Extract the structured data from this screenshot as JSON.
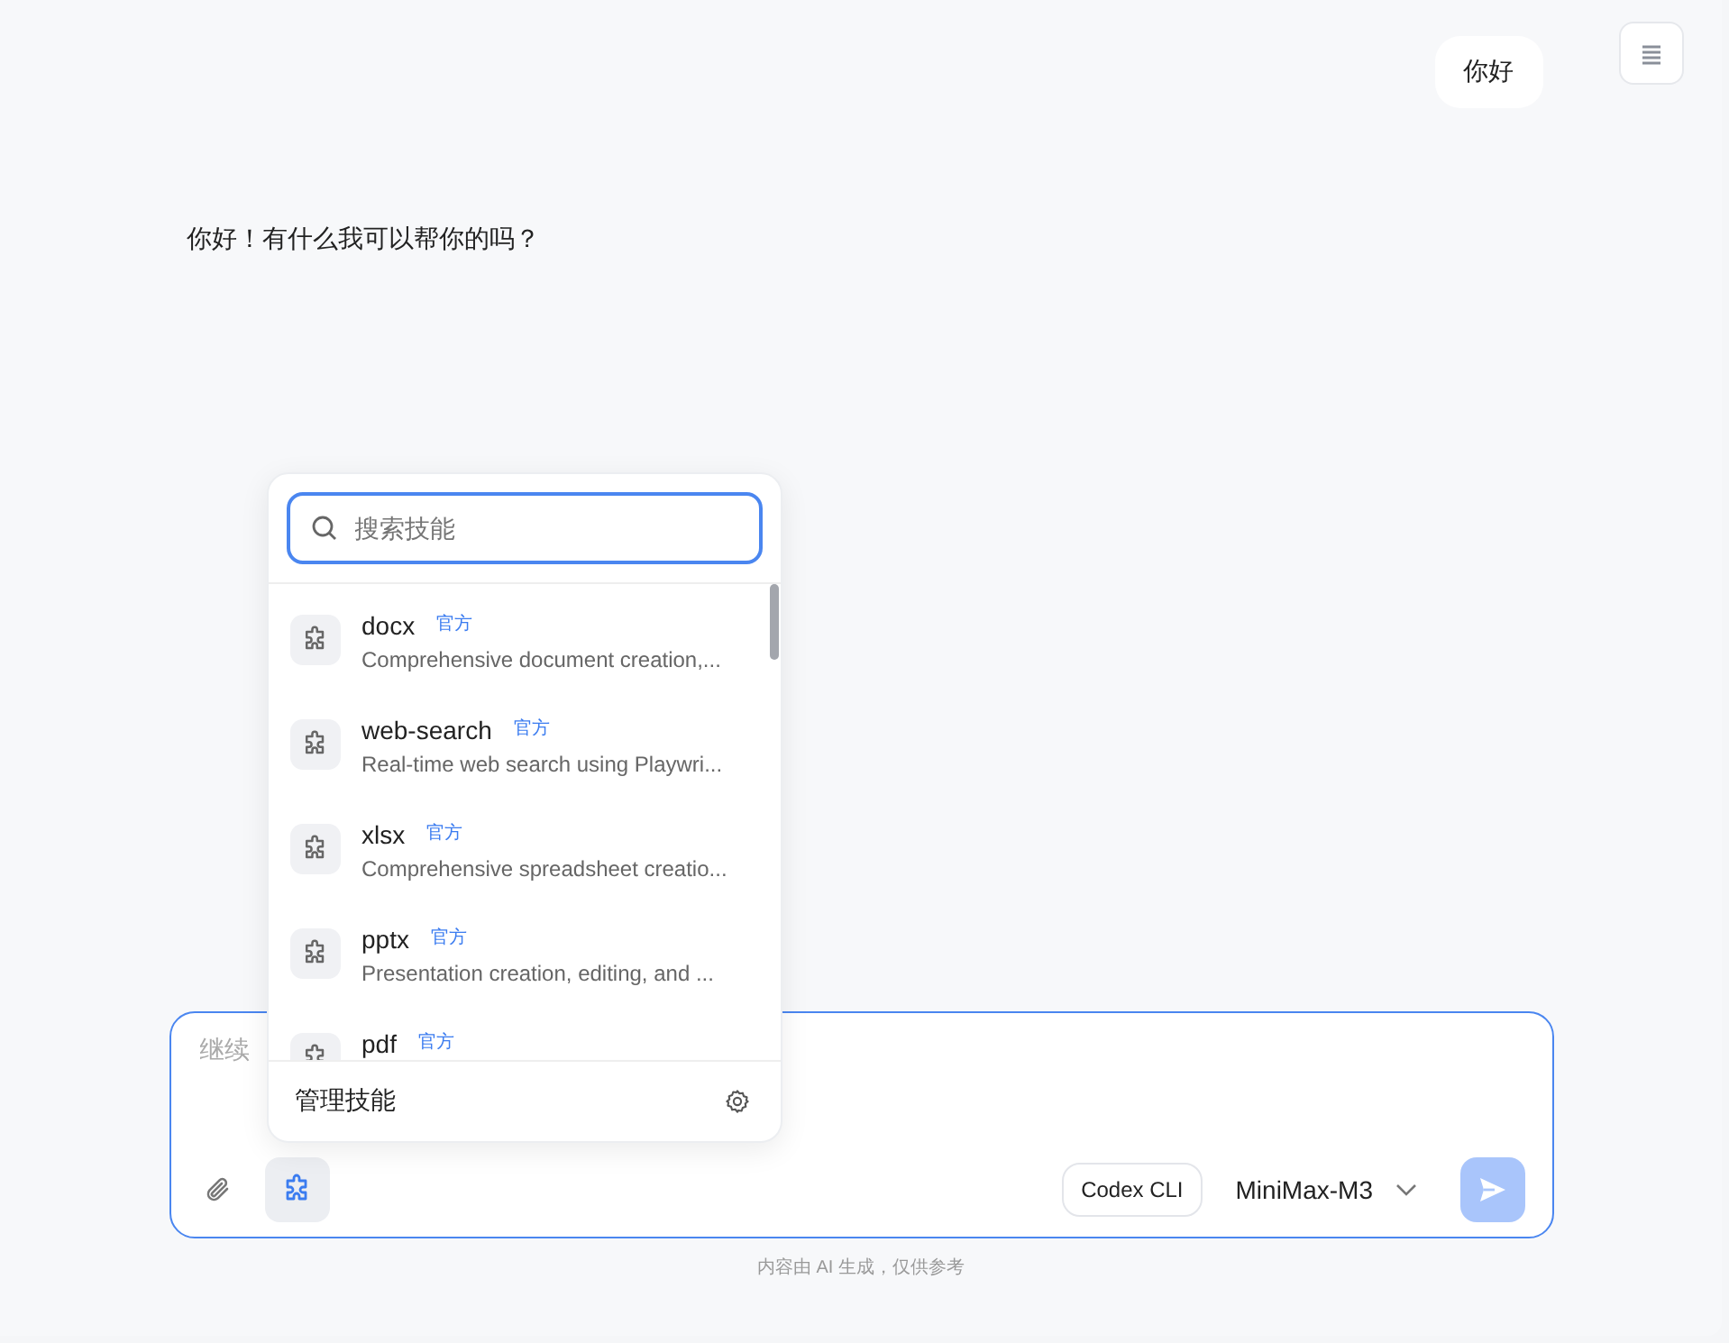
{
  "chat": {
    "user_message": "你好",
    "assistant_message": "你好！有什么我可以帮你的吗？"
  },
  "composer": {
    "placeholder": "继续",
    "skills_button": {
      "active": true
    },
    "agent": "Codex CLI",
    "model": "MiniMax-M3",
    "send": {
      "disabled": true
    }
  },
  "skills_popup": {
    "search": {
      "placeholder": "搜索技能"
    },
    "skills": [
      {
        "name": "docx",
        "badge": "官方",
        "description": "Comprehensive document creation,..."
      },
      {
        "name": "web-search",
        "badge": "官方",
        "description": "Real-time web search using Playwri..."
      },
      {
        "name": "xlsx",
        "badge": "官方",
        "description": "Comprehensive spreadsheet creatio..."
      },
      {
        "name": "pptx",
        "badge": "官方",
        "description": "Presentation creation, editing, and ..."
      },
      {
        "name": "pdf",
        "badge": "官方"
      }
    ],
    "manage": "管理技能"
  },
  "footer": "内容由 AI 生成，仅供参考"
}
